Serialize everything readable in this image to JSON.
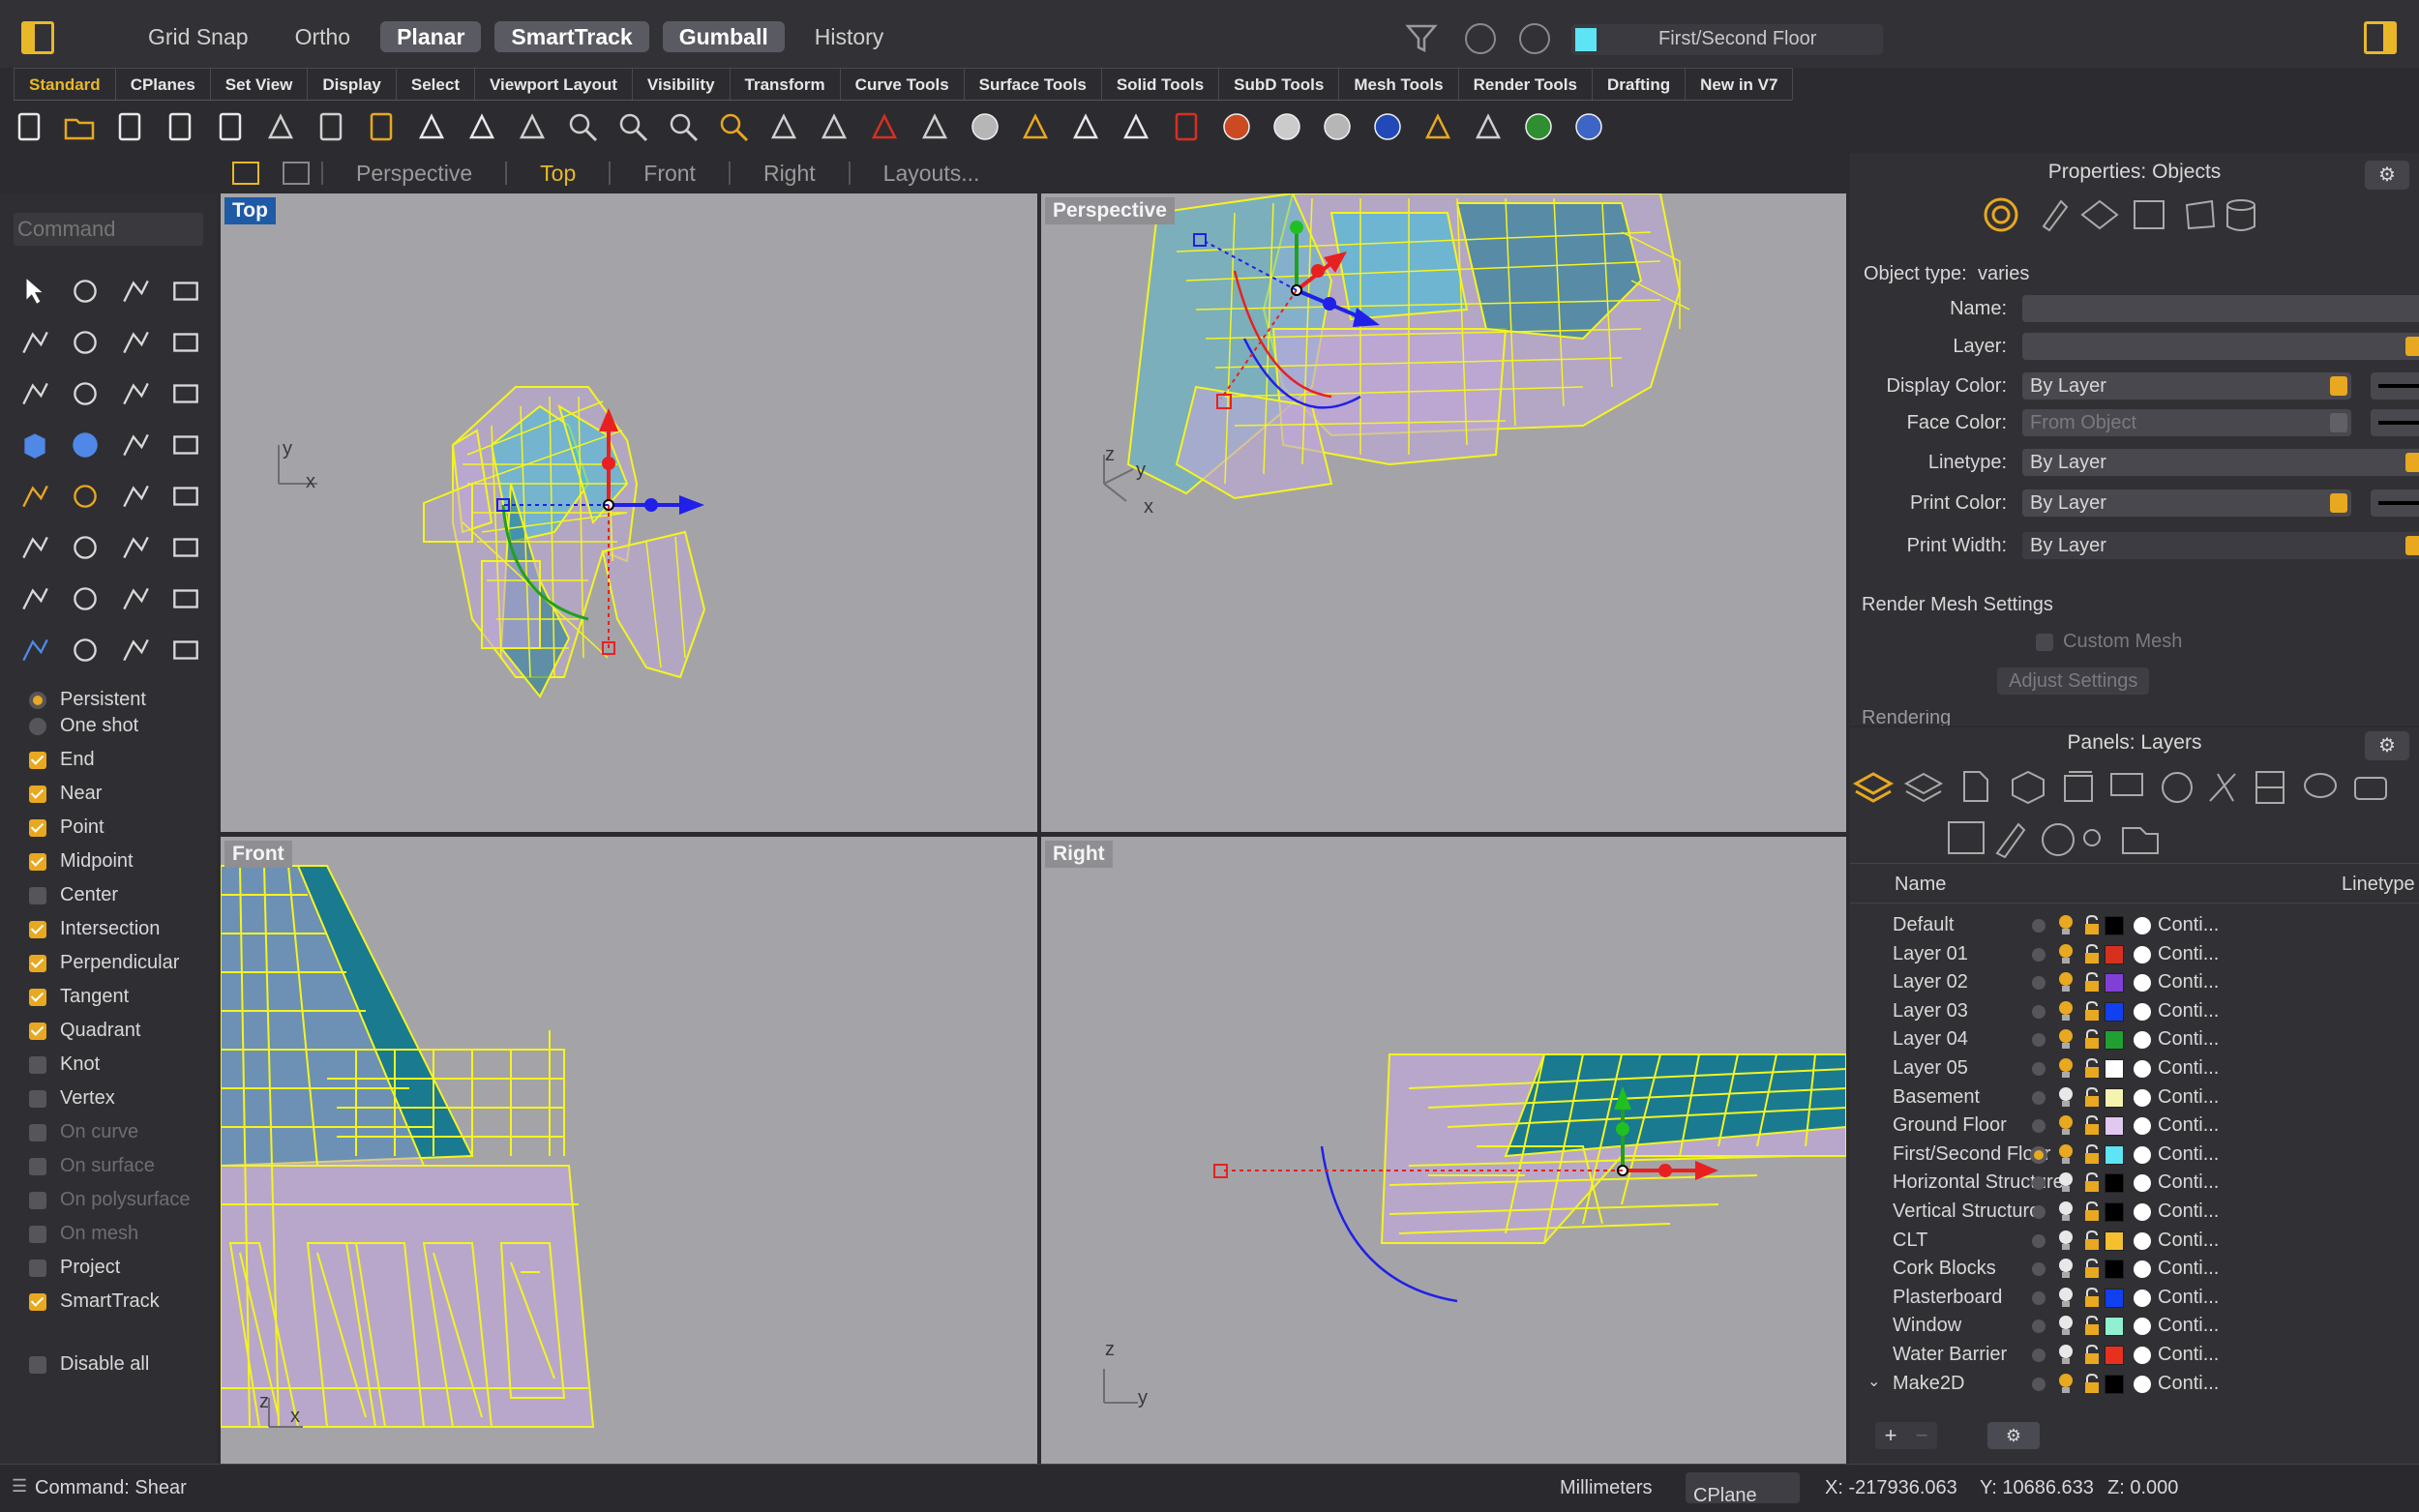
{
  "top": {
    "modes": [
      {
        "label": "Grid Snap",
        "on": false
      },
      {
        "label": "Ortho",
        "on": false
      },
      {
        "label": "Planar",
        "on": true
      },
      {
        "label": "SmartTrack",
        "on": true
      },
      {
        "label": "Gumball",
        "on": true
      },
      {
        "label": "History",
        "on": false
      }
    ],
    "current_layer": "First/Second Floor",
    "current_layer_color": "#5ee4f4"
  },
  "tabs": [
    "Standard",
    "CPlanes",
    "Set View",
    "Display",
    "Select",
    "Viewport Layout",
    "Visibility",
    "Transform",
    "Curve Tools",
    "Surface Tools",
    "Solid Tools",
    "SubD Tools",
    "Mesh Tools",
    "Render Tools",
    "Drafting",
    "New in V7"
  ],
  "toolbar_icons": [
    "new-file-icon",
    "open-folder-icon",
    "save-icon",
    "print-icon",
    "import-icon",
    "cut-icon",
    "copy-icon",
    "paste-icon",
    "undo-icon",
    "pan-hand-icon",
    "rotate-view-icon",
    "zoom-icon",
    "zoom-window-icon",
    "zoom-extents-icon",
    "zoom-selected-icon",
    "undo-view-icon",
    "four-viewports-icon",
    "car-icon",
    "grid-icon",
    "circle-snap-icon",
    "points-icon",
    "lightbulb-icon",
    "lock-icon",
    "layer-icon",
    "color-wheel-icon",
    "shaded-sphere-icon",
    "rendered-sphere-icon",
    "material-sphere-icon",
    "dimension-icon",
    "hierarchy-icon",
    "globe-icon",
    "help-icon"
  ],
  "viewport_tabs": [
    "Perspective",
    "Top",
    "Front",
    "Right",
    "Layouts..."
  ],
  "active_viewport_tab": "Top",
  "command": {
    "placeholder": "Command"
  },
  "osnap": {
    "modes": [
      {
        "label": "Persistent",
        "on": true
      },
      {
        "label": "One shot",
        "on": false
      }
    ],
    "items": [
      {
        "label": "End",
        "checked": true
      },
      {
        "label": "Near",
        "checked": true
      },
      {
        "label": "Point",
        "checked": true
      },
      {
        "label": "Midpoint",
        "checked": true
      },
      {
        "label": "Center",
        "checked": false
      },
      {
        "label": "Intersection",
        "checked": true
      },
      {
        "label": "Perpendicular",
        "checked": true
      },
      {
        "label": "Tangent",
        "checked": true
      },
      {
        "label": "Quadrant",
        "checked": true
      },
      {
        "label": "Knot",
        "checked": false
      },
      {
        "label": "Vertex",
        "checked": false
      },
      {
        "label": "On curve",
        "checked": false,
        "dim": true
      },
      {
        "label": "On surface",
        "checked": false,
        "dim": true
      },
      {
        "label": "On polysurface",
        "checked": false,
        "dim": true
      },
      {
        "label": "On mesh",
        "checked": false,
        "dim": true
      },
      {
        "label": "Project",
        "checked": false
      },
      {
        "label": "SmartTrack",
        "checked": true
      }
    ],
    "disable_all": "Disable all"
  },
  "viewports": {
    "top": "Top",
    "perspective": "Perspective",
    "front": "Front",
    "right": "Right"
  },
  "axes": {
    "x": "x",
    "y": "y",
    "z": "z"
  },
  "properties": {
    "title": "Properties: Objects",
    "object_type_label": "Object type:",
    "object_type": "varies",
    "name_label": "Name:",
    "layer_label": "Layer:",
    "display_color_label": "Display Color:",
    "display_color": "By Layer",
    "face_color_label": "Face Color:",
    "face_color": "From Object",
    "linetype_label": "Linetype:",
    "linetype": "By Layer",
    "print_color_label": "Print Color:",
    "print_color": "By Layer",
    "print_width_label": "Print Width:",
    "print_width": "By Layer",
    "render_mesh": "Render Mesh Settings",
    "custom_mesh": "Custom Mesh",
    "adjust_settings": "Adjust Settings",
    "rendering": "Rendering"
  },
  "layers": {
    "title": "Panels: Layers",
    "col_name": "Name",
    "col_linetype": "Linetype",
    "rows": [
      {
        "name": "Default",
        "color": "#000000",
        "linetype": "Conti...",
        "current": false,
        "light_on": true
      },
      {
        "name": "Layer 01",
        "color": "#d83020",
        "linetype": "Conti...",
        "current": false,
        "light_on": true
      },
      {
        "name": "Layer 02",
        "color": "#8040d8",
        "linetype": "Conti...",
        "current": false,
        "light_on": true
      },
      {
        "name": "Layer 03",
        "color": "#1040f0",
        "linetype": "Conti...",
        "current": false,
        "light_on": true
      },
      {
        "name": "Layer 04",
        "color": "#20a030",
        "linetype": "Conti...",
        "current": false,
        "light_on": true
      },
      {
        "name": "Layer 05",
        "color": "#ffffff",
        "linetype": "Conti...",
        "current": false,
        "light_on": true
      },
      {
        "name": "Basement",
        "color": "#f4f4b0",
        "linetype": "Conti...",
        "current": false,
        "light_on": false
      },
      {
        "name": "Ground Floor",
        "color": "#e0c8f0",
        "linetype": "Conti...",
        "current": false,
        "light_on": true
      },
      {
        "name": "First/Second Floor",
        "color": "#5ee4f4",
        "linetype": "Conti...",
        "current": true,
        "light_on": true
      },
      {
        "name": "Horizontal Structure",
        "color": "#000000",
        "linetype": "Conti...",
        "current": false,
        "light_on": false
      },
      {
        "name": "Vertical Structure",
        "color": "#000000",
        "linetype": "Conti...",
        "current": false,
        "light_on": false
      },
      {
        "name": "CLT",
        "color": "#f4c030",
        "linetype": "Conti...",
        "current": false,
        "light_on": false
      },
      {
        "name": "Cork Blocks",
        "color": "#000000",
        "linetype": "Conti...",
        "current": false,
        "light_on": false
      },
      {
        "name": "Plasterboard",
        "color": "#1040f0",
        "linetype": "Conti...",
        "current": false,
        "light_on": false
      },
      {
        "name": "Window",
        "color": "#90f0d0",
        "linetype": "Conti...",
        "current": false,
        "light_on": false
      },
      {
        "name": "Water Barrier",
        "color": "#e83020",
        "linetype": "Conti...",
        "current": false,
        "light_on": false
      },
      {
        "name": "Make2D",
        "color": "#000000",
        "linetype": "Conti...",
        "current": false,
        "light_on": true
      }
    ]
  },
  "status": {
    "command": "Command: Shear",
    "units": "Millimeters",
    "cplane": "CPlane",
    "x": "X: -217936.063",
    "y": "Y: 10686.633",
    "z": "Z: 0.000"
  }
}
